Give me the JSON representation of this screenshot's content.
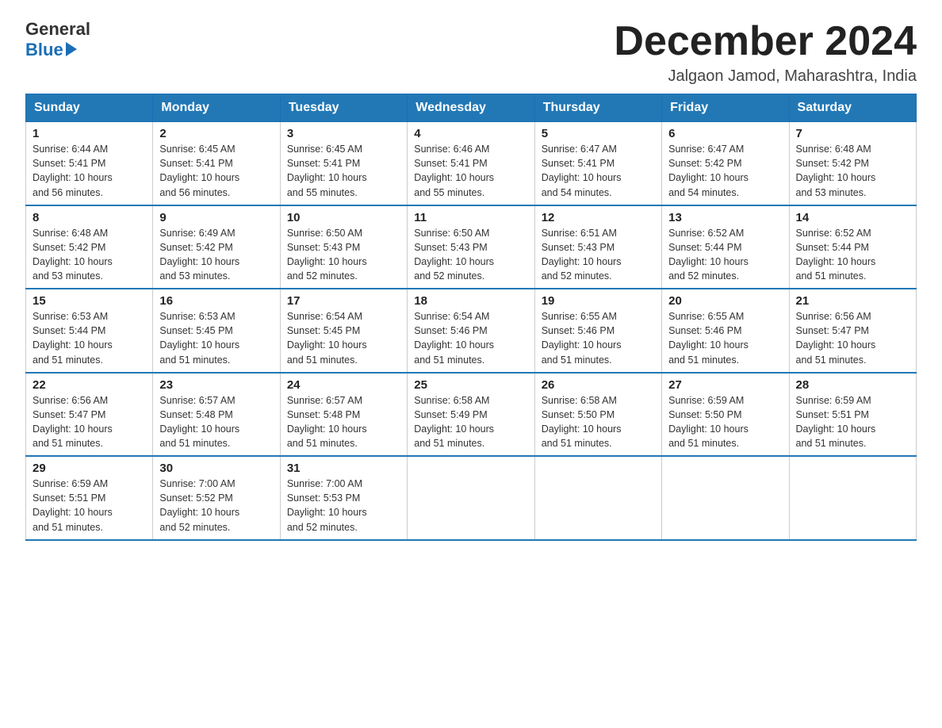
{
  "logo": {
    "general": "General",
    "blue": "Blue"
  },
  "header": {
    "month_year": "December 2024",
    "location": "Jalgaon Jamod, Maharashtra, India"
  },
  "weekdays": [
    "Sunday",
    "Monday",
    "Tuesday",
    "Wednesday",
    "Thursday",
    "Friday",
    "Saturday"
  ],
  "weeks": [
    [
      {
        "day": "1",
        "sunrise": "6:44 AM",
        "sunset": "5:41 PM",
        "daylight": "10 hours and 56 minutes."
      },
      {
        "day": "2",
        "sunrise": "6:45 AM",
        "sunset": "5:41 PM",
        "daylight": "10 hours and 56 minutes."
      },
      {
        "day": "3",
        "sunrise": "6:45 AM",
        "sunset": "5:41 PM",
        "daylight": "10 hours and 55 minutes."
      },
      {
        "day": "4",
        "sunrise": "6:46 AM",
        "sunset": "5:41 PM",
        "daylight": "10 hours and 55 minutes."
      },
      {
        "day": "5",
        "sunrise": "6:47 AM",
        "sunset": "5:41 PM",
        "daylight": "10 hours and 54 minutes."
      },
      {
        "day": "6",
        "sunrise": "6:47 AM",
        "sunset": "5:42 PM",
        "daylight": "10 hours and 54 minutes."
      },
      {
        "day": "7",
        "sunrise": "6:48 AM",
        "sunset": "5:42 PM",
        "daylight": "10 hours and 53 minutes."
      }
    ],
    [
      {
        "day": "8",
        "sunrise": "6:48 AM",
        "sunset": "5:42 PM",
        "daylight": "10 hours and 53 minutes."
      },
      {
        "day": "9",
        "sunrise": "6:49 AM",
        "sunset": "5:42 PM",
        "daylight": "10 hours and 53 minutes."
      },
      {
        "day": "10",
        "sunrise": "6:50 AM",
        "sunset": "5:43 PM",
        "daylight": "10 hours and 52 minutes."
      },
      {
        "day": "11",
        "sunrise": "6:50 AM",
        "sunset": "5:43 PM",
        "daylight": "10 hours and 52 minutes."
      },
      {
        "day": "12",
        "sunrise": "6:51 AM",
        "sunset": "5:43 PM",
        "daylight": "10 hours and 52 minutes."
      },
      {
        "day": "13",
        "sunrise": "6:52 AM",
        "sunset": "5:44 PM",
        "daylight": "10 hours and 52 minutes."
      },
      {
        "day": "14",
        "sunrise": "6:52 AM",
        "sunset": "5:44 PM",
        "daylight": "10 hours and 51 minutes."
      }
    ],
    [
      {
        "day": "15",
        "sunrise": "6:53 AM",
        "sunset": "5:44 PM",
        "daylight": "10 hours and 51 minutes."
      },
      {
        "day": "16",
        "sunrise": "6:53 AM",
        "sunset": "5:45 PM",
        "daylight": "10 hours and 51 minutes."
      },
      {
        "day": "17",
        "sunrise": "6:54 AM",
        "sunset": "5:45 PM",
        "daylight": "10 hours and 51 minutes."
      },
      {
        "day": "18",
        "sunrise": "6:54 AM",
        "sunset": "5:46 PM",
        "daylight": "10 hours and 51 minutes."
      },
      {
        "day": "19",
        "sunrise": "6:55 AM",
        "sunset": "5:46 PM",
        "daylight": "10 hours and 51 minutes."
      },
      {
        "day": "20",
        "sunrise": "6:55 AM",
        "sunset": "5:46 PM",
        "daylight": "10 hours and 51 minutes."
      },
      {
        "day": "21",
        "sunrise": "6:56 AM",
        "sunset": "5:47 PM",
        "daylight": "10 hours and 51 minutes."
      }
    ],
    [
      {
        "day": "22",
        "sunrise": "6:56 AM",
        "sunset": "5:47 PM",
        "daylight": "10 hours and 51 minutes."
      },
      {
        "day": "23",
        "sunrise": "6:57 AM",
        "sunset": "5:48 PM",
        "daylight": "10 hours and 51 minutes."
      },
      {
        "day": "24",
        "sunrise": "6:57 AM",
        "sunset": "5:48 PM",
        "daylight": "10 hours and 51 minutes."
      },
      {
        "day": "25",
        "sunrise": "6:58 AM",
        "sunset": "5:49 PM",
        "daylight": "10 hours and 51 minutes."
      },
      {
        "day": "26",
        "sunrise": "6:58 AM",
        "sunset": "5:50 PM",
        "daylight": "10 hours and 51 minutes."
      },
      {
        "day": "27",
        "sunrise": "6:59 AM",
        "sunset": "5:50 PM",
        "daylight": "10 hours and 51 minutes."
      },
      {
        "day": "28",
        "sunrise": "6:59 AM",
        "sunset": "5:51 PM",
        "daylight": "10 hours and 51 minutes."
      }
    ],
    [
      {
        "day": "29",
        "sunrise": "6:59 AM",
        "sunset": "5:51 PM",
        "daylight": "10 hours and 51 minutes."
      },
      {
        "day": "30",
        "sunrise": "7:00 AM",
        "sunset": "5:52 PM",
        "daylight": "10 hours and 52 minutes."
      },
      {
        "day": "31",
        "sunrise": "7:00 AM",
        "sunset": "5:53 PM",
        "daylight": "10 hours and 52 minutes."
      },
      null,
      null,
      null,
      null
    ]
  ],
  "cell_labels": {
    "sunrise": "Sunrise:",
    "sunset": "Sunset:",
    "daylight": "Daylight:"
  }
}
